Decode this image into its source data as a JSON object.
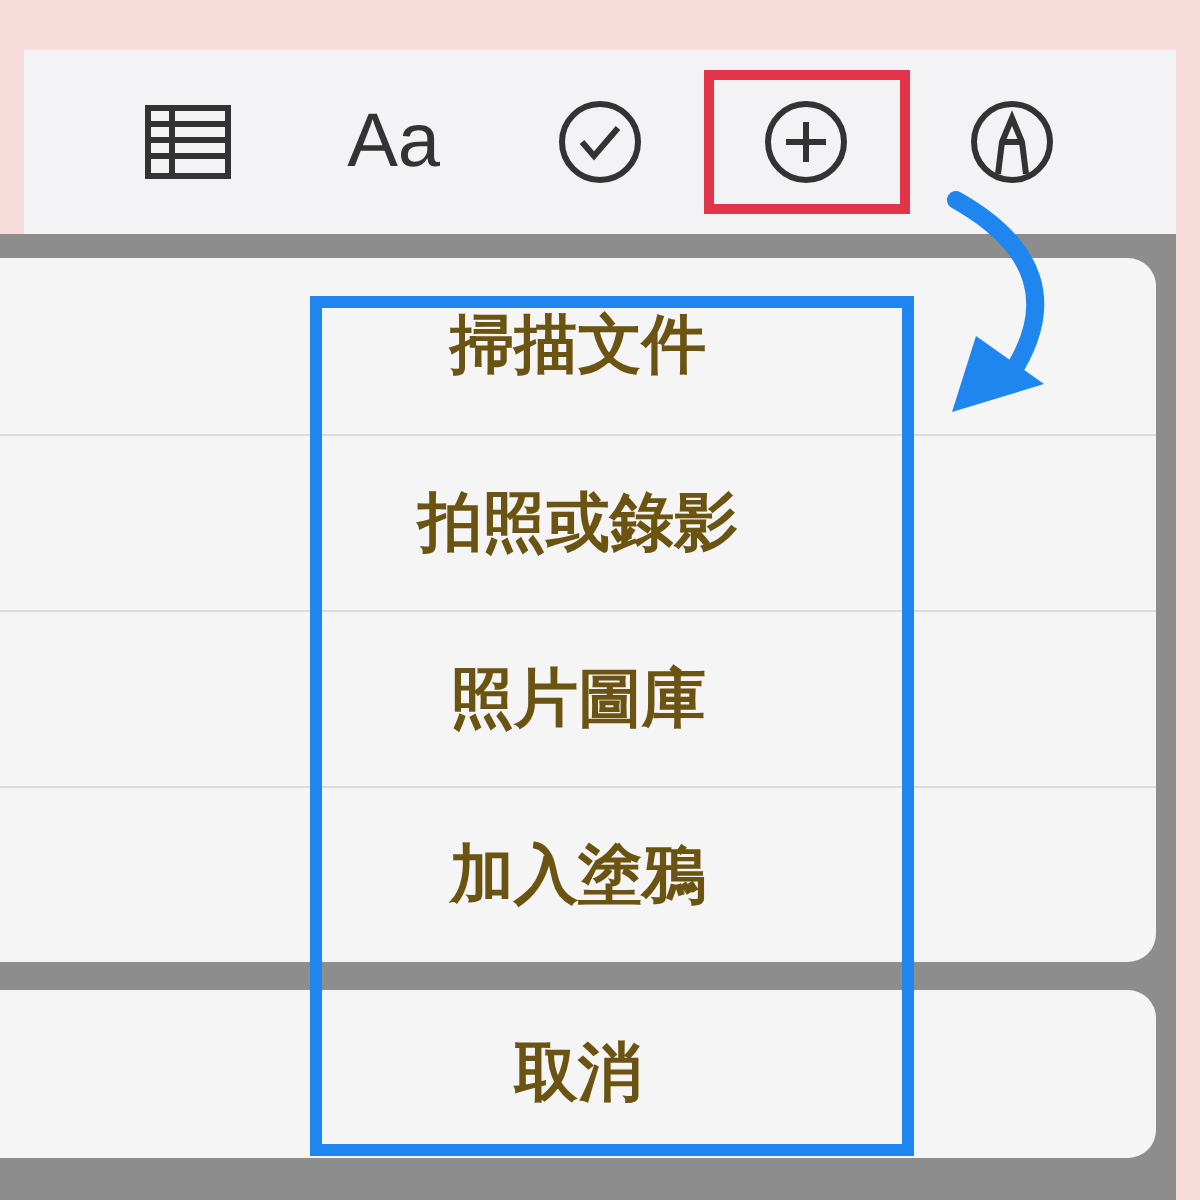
{
  "toolbar": {
    "buttons": [
      {
        "kind": "table",
        "highlighted": false
      },
      {
        "kind": "text",
        "label": "Aa",
        "highlighted": false
      },
      {
        "kind": "checklist",
        "highlighted": false
      },
      {
        "kind": "add",
        "highlighted": true
      },
      {
        "kind": "markup",
        "highlighted": false
      }
    ]
  },
  "action_sheet": {
    "highlighted": true,
    "options": [
      "掃描文件",
      "拍照或錄影",
      "照片圖庫",
      "加入塗鴉"
    ],
    "cancel": "取消"
  }
}
